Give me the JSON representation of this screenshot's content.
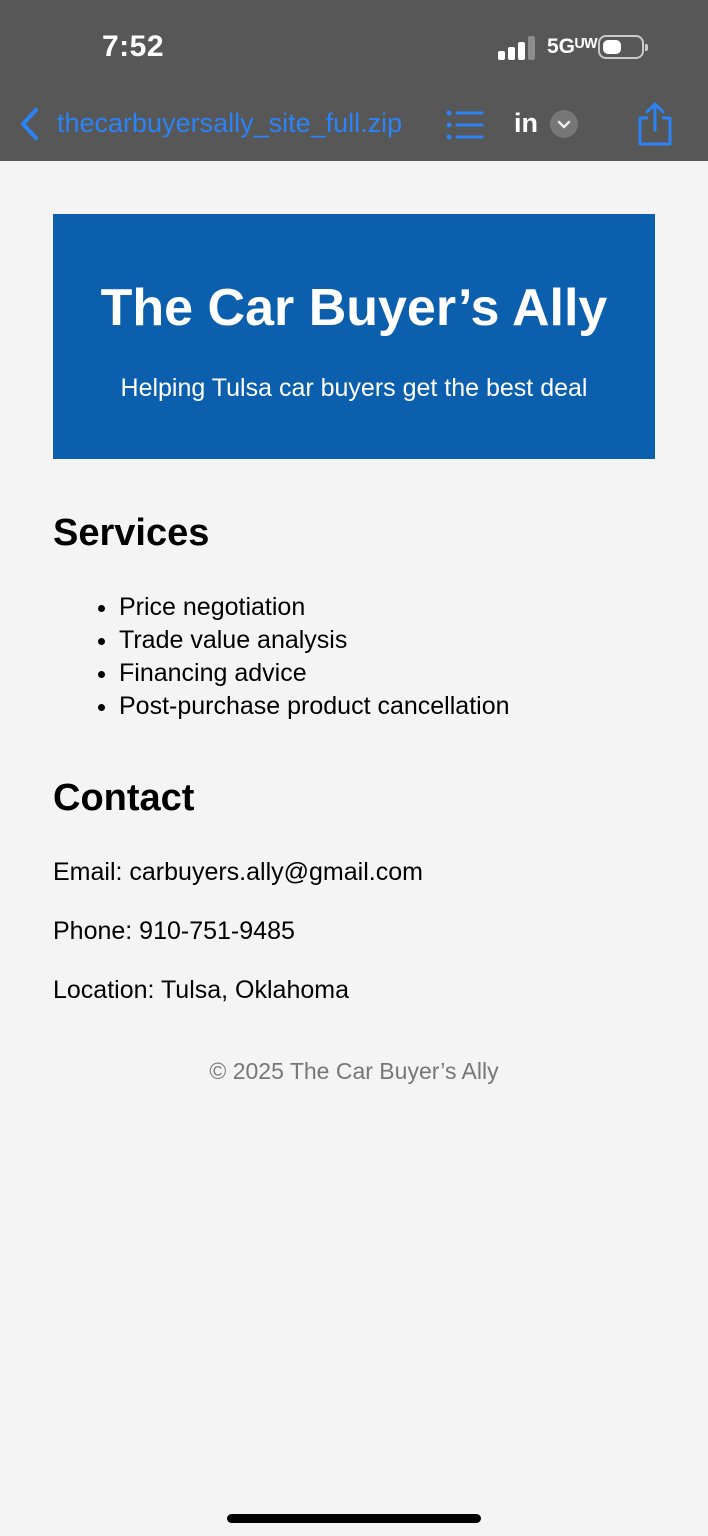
{
  "status_bar": {
    "time": "7:52",
    "network": "5Gᵁᵂ"
  },
  "toolbar": {
    "filename": "thecarbuyersally_site_full.zip",
    "language": "in",
    "accent_color": "#2b83f6"
  },
  "banner": {
    "title": "The Car Buyer’s Ally",
    "subtitle": "Helping Tulsa car buyers get the best deal",
    "color": "#0b5fad"
  },
  "services": {
    "heading": "Services",
    "items": [
      "Price negotiation",
      "Trade value analysis",
      "Financing advice",
      "Post-purchase product cancellation"
    ]
  },
  "contact": {
    "heading": "Contact",
    "email": "Email: carbuyers.ally@gmail.com",
    "phone": "Phone: 910-751-9485",
    "location": "Location: Tulsa, Oklahoma"
  },
  "footer": {
    "copyright": "© 2025 The Car Buyer’s Ally"
  }
}
